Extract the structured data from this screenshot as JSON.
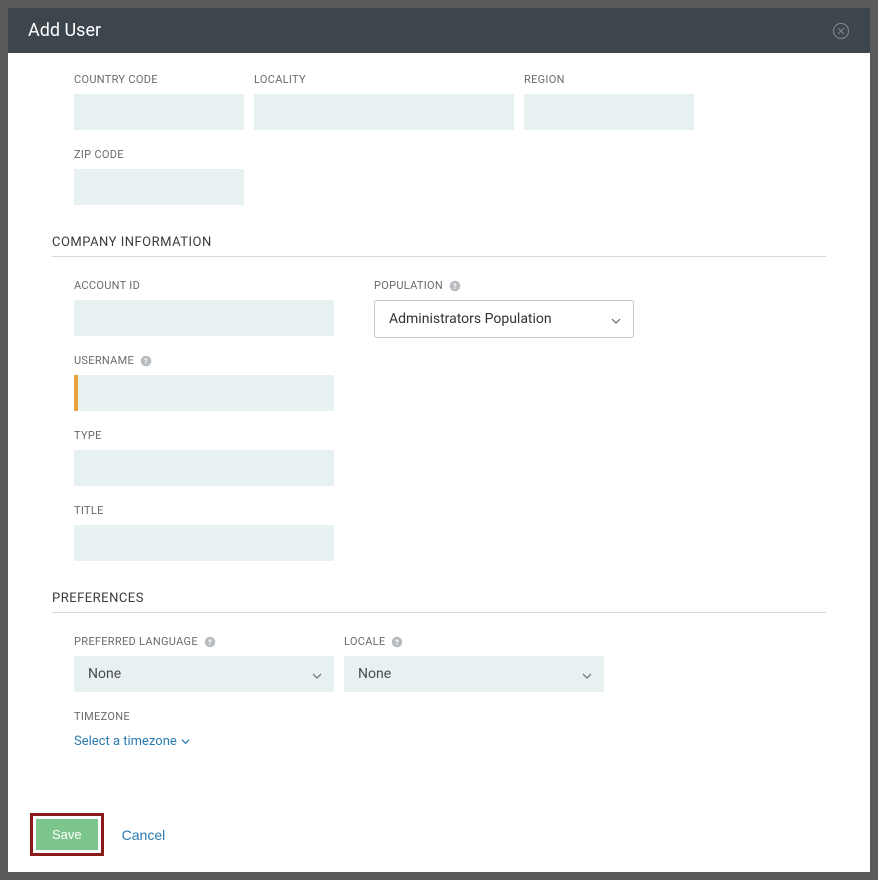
{
  "modal": {
    "title": "Add User"
  },
  "address": {
    "country_code_label": "Country Code",
    "locality_label": "Locality",
    "region_label": "Region",
    "zip_code_label": "Zip Code"
  },
  "company": {
    "section_title": "Company Information",
    "account_id_label": "Account ID",
    "population_label": "Population",
    "population_value": "Administrators Population",
    "username_label": "Username",
    "type_label": "Type",
    "title_label": "Title"
  },
  "preferences": {
    "section_title": "Preferences",
    "preferred_language_label": "Preferred Language",
    "preferred_language_value": "None",
    "locale_label": "Locale",
    "locale_value": "None",
    "timezone_label": "Timezone",
    "timezone_action": "Select a timezone"
  },
  "footer": {
    "save_label": "Save",
    "cancel_label": "Cancel"
  }
}
